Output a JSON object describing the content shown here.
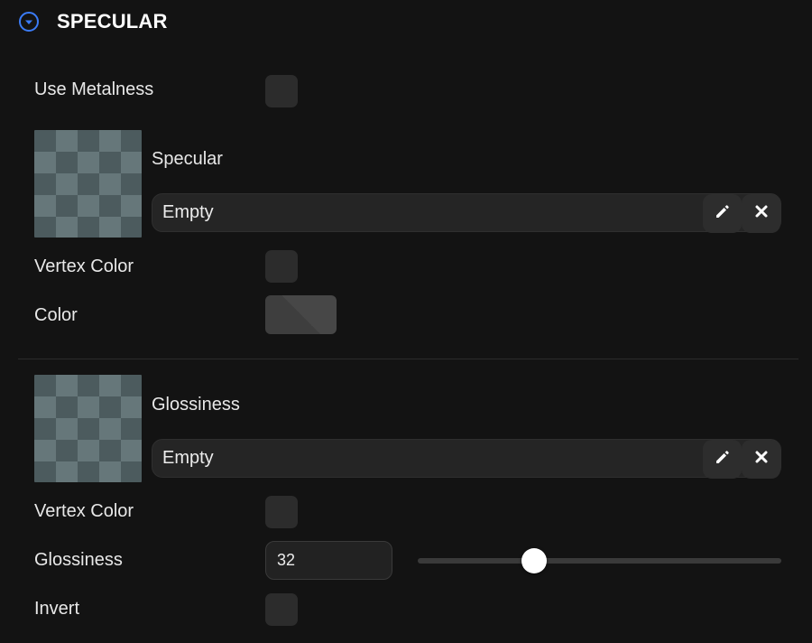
{
  "section": {
    "title": "SPECULAR",
    "toggle_icon": "chevron-down-circle-icon",
    "accent": "#3b7bf6"
  },
  "specular": {
    "use_metalness": {
      "label": "Use Metalness",
      "checked": false
    },
    "map": {
      "label": "Specular",
      "value": "Empty"
    },
    "vertex_color": {
      "label": "Vertex Color",
      "checked": false
    },
    "color": {
      "label": "Color",
      "value": "#424242"
    }
  },
  "glossiness": {
    "map": {
      "label": "Glossiness",
      "value": "Empty"
    },
    "vertex_color": {
      "label": "Vertex Color",
      "checked": false
    },
    "value": {
      "label": "Glossiness",
      "value": "32",
      "min": 0,
      "max": 100
    },
    "invert": {
      "label": "Invert",
      "checked": false
    }
  },
  "icons": {
    "edit": "pencil-icon",
    "clear": "close-icon"
  }
}
